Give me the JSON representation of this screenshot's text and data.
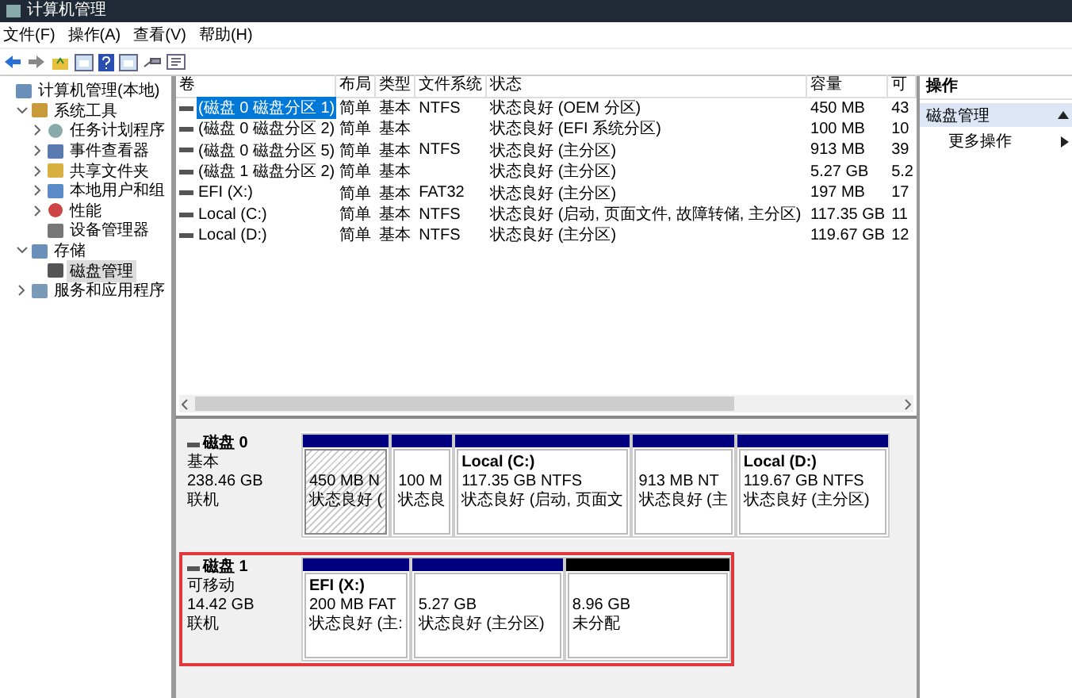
{
  "window": {
    "title": "计算机管理"
  },
  "menu": [
    "文件(F)",
    "操作(A)",
    "查看(V)",
    "帮助(H)"
  ],
  "tree": [
    {
      "label": "计算机管理(本地)",
      "selected": false,
      "children": [
        {
          "label": "系统工具",
          "expanded": true,
          "selected": false,
          "children": [
            {
              "label": "任务计划程序",
              "expanded": false,
              "selected": false
            },
            {
              "label": "事件查看器",
              "expanded": false,
              "selected": false
            },
            {
              "label": "共享文件夹",
              "expanded": false,
              "selected": false
            },
            {
              "label": "本地用户和组",
              "expanded": false,
              "selected": false
            },
            {
              "label": "性能",
              "expanded": false,
              "selected": false
            },
            {
              "label": "设备管理器",
              "selected": false
            }
          ]
        },
        {
          "label": "存储",
          "expanded": true,
          "selected": false,
          "children": [
            {
              "label": "磁盘管理",
              "selected": true
            }
          ]
        },
        {
          "label": "服务和应用程序",
          "expanded": false,
          "selected": false
        }
      ]
    }
  ],
  "table": {
    "columns": [
      "卷",
      "布局",
      "类型",
      "文件系统",
      "状态",
      "容量",
      "可"
    ],
    "rows": [
      {
        "cells": [
          "(磁盘 0 磁盘分区 1)",
          "简单",
          "基本",
          "NTFS",
          "状态良好 (OEM 分区)",
          "450 MB",
          "43"
        ],
        "selected": true
      },
      {
        "cells": [
          "(磁盘 0 磁盘分区 2)",
          "简单",
          "基本",
          "",
          "状态良好 (EFI 系统分区)",
          "100 MB",
          "10"
        ],
        "selected": false
      },
      {
        "cells": [
          "(磁盘 0 磁盘分区 5)",
          "简单",
          "基本",
          "NTFS",
          "状态良好 (主分区)",
          "913 MB",
          "39"
        ],
        "selected": false
      },
      {
        "cells": [
          "(磁盘 1 磁盘分区 2)",
          "简单",
          "基本",
          "",
          "状态良好 (主分区)",
          "5.27 GB",
          "5.2"
        ],
        "selected": false
      },
      {
        "cells": [
          "EFI (X:)",
          "简单",
          "基本",
          "FAT32",
          "状态良好 (主分区)",
          "197 MB",
          "17"
        ],
        "selected": false
      },
      {
        "cells": [
          "Local (C:)",
          "简单",
          "基本",
          "NTFS",
          "状态良好 (启动, 页面文件, 故障转储, 主分区)",
          "117.35 GB",
          "11"
        ],
        "selected": false
      },
      {
        "cells": [
          "Local (D:)",
          "简单",
          "基本",
          "NTFS",
          "状态良好 (主分区)",
          "119.67 GB",
          "12"
        ],
        "selected": false
      }
    ]
  },
  "disks": [
    {
      "name": "磁盘 0",
      "type": "基本",
      "size": "238.46 GB",
      "status": "联机",
      "highlighted": false,
      "partitions": [
        {
          "kind": "primary",
          "selected": true,
          "lines": [
            "450 MB N",
            "状态良好 ("
          ]
        },
        {
          "kind": "primary",
          "selected": false,
          "lines": [
            "100 M",
            "状态良"
          ]
        },
        {
          "kind": "primary",
          "selected": false,
          "name": "Local  (C:)",
          "lines": [
            "117.35 GB NTFS",
            "状态良好 (启动, 页面文"
          ]
        },
        {
          "kind": "primary",
          "selected": false,
          "lines": [
            "913 MB NT",
            "状态良好 (主"
          ]
        },
        {
          "kind": "primary",
          "selected": false,
          "name": "Local  (D:)",
          "lines": [
            "119.67 GB NTFS",
            "状态良好 (主分区)"
          ]
        }
      ]
    },
    {
      "name": "磁盘 1",
      "type": "可移动",
      "size": "14.42 GB",
      "status": "联机",
      "highlighted": true,
      "partitions": [
        {
          "kind": "primary",
          "selected": false,
          "name": "EFI  (X:)",
          "lines": [
            "200 MB FAT",
            "状态良好 (主:"
          ]
        },
        {
          "kind": "primary",
          "selected": false,
          "lines": [
            "5.27 GB",
            "状态良好 (主分区)"
          ]
        },
        {
          "kind": "unallocated",
          "selected": false,
          "lines": [
            "8.96 GB",
            "未分配"
          ]
        }
      ]
    }
  ],
  "actions": {
    "title": "操作",
    "section": "磁盘管理",
    "items": [
      "更多操作"
    ]
  }
}
